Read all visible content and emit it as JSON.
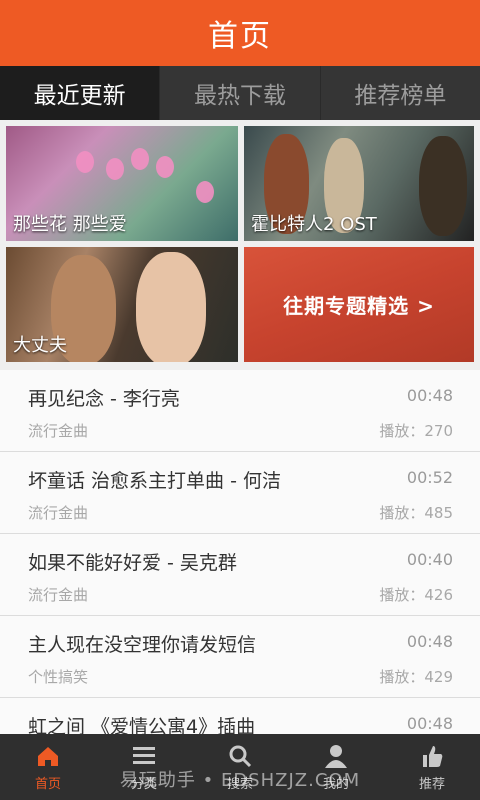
{
  "header": {
    "title": "首页"
  },
  "tabs": [
    {
      "label": "最近更新",
      "active": true
    },
    {
      "label": "最热下载",
      "active": false
    },
    {
      "label": "推荐榜单",
      "active": false
    }
  ],
  "tiles": [
    {
      "caption": "那些花 那些爱"
    },
    {
      "caption": "霍比特人2 OST"
    },
    {
      "caption": "大丈夫"
    },
    {
      "caption": "往期专题精选 >"
    }
  ],
  "songs": [
    {
      "title": "再见纪念 - 李行亮",
      "duration": "00:48",
      "category": "流行金曲",
      "plays": "播放：270"
    },
    {
      "title": "坏童话 治愈系主打单曲 - 何洁",
      "duration": "00:52",
      "category": "流行金曲",
      "plays": "播放：485"
    },
    {
      "title": "如果不能好好爱 - 吴克群",
      "duration": "00:40",
      "category": "流行金曲",
      "plays": "播放：426"
    },
    {
      "title": "主人现在没空理你请发短信",
      "duration": "00:48",
      "category": "个性搞笑",
      "plays": "播放：429"
    },
    {
      "title": "虹之间 《爱情公寓4》插曲",
      "duration": "00:48",
      "category": "",
      "plays": ""
    }
  ],
  "bottom_nav": [
    {
      "label": "首页",
      "icon": "home-icon",
      "active": true
    },
    {
      "label": "分类",
      "icon": "menu-icon",
      "active": false
    },
    {
      "label": "搜索",
      "icon": "search-icon",
      "active": false
    },
    {
      "label": "我的",
      "icon": "user-icon",
      "active": false
    },
    {
      "label": "推荐",
      "icon": "thumbs-up-icon",
      "active": false
    }
  ],
  "watermark": "易玩助手 • EDSHZJZ.COM",
  "colors": {
    "accent": "#ee5a24",
    "tab_bar": "#353535",
    "bottom_bar": "#2f2f2f"
  }
}
